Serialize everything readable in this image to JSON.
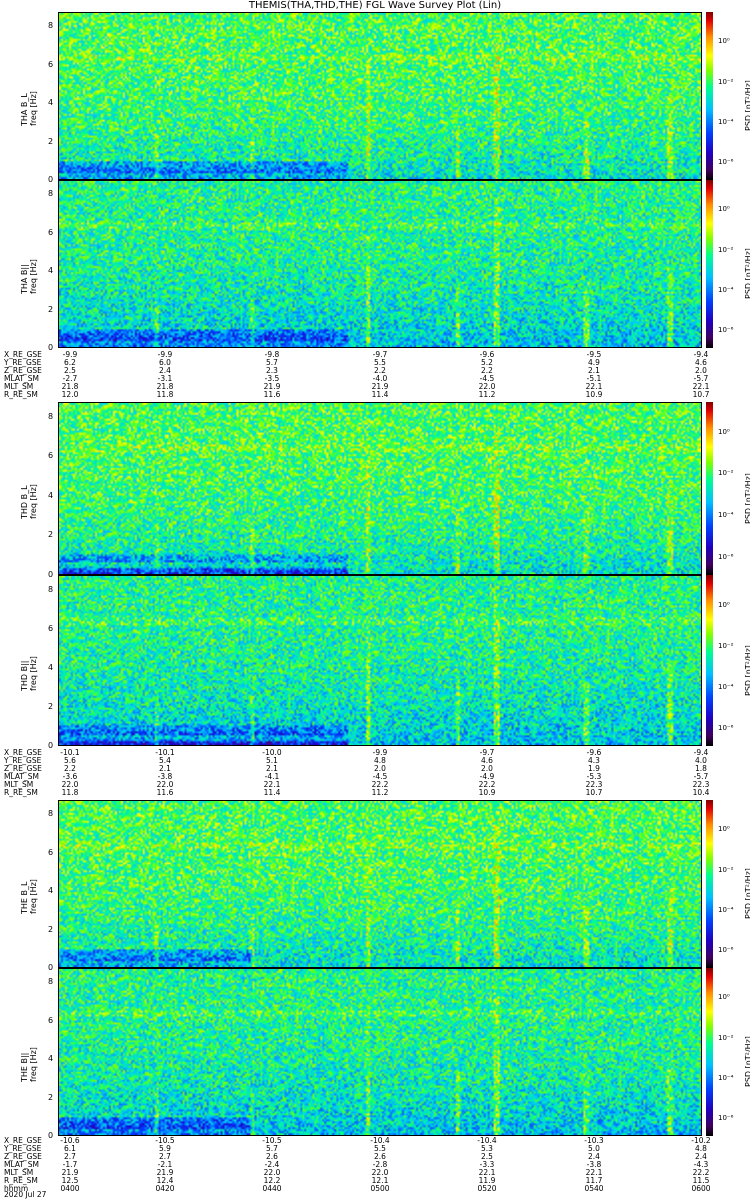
{
  "title": "THEMIS(THA,THD,THE) FGL Wave Survey Plot (Lin)",
  "colorbar": {
    "label": "PSD [nT²/Hz]",
    "ticks": [
      "10⁰",
      "10⁻²",
      "10⁻⁴",
      "10⁻⁶"
    ]
  },
  "row_labels": [
    "X_RE_GSE",
    "Y_RE_GSE",
    "Z_RE_GSE",
    "MLAT_SM",
    "MLT_SM",
    "R_RE_SM"
  ],
  "time_label": "hhmm",
  "date": "2020 Jul 27",
  "chart_data": {
    "type": "heatmap",
    "x_ticks": [
      "0400",
      "0420",
      "0440",
      "0500",
      "0520",
      "0540",
      "0600"
    ],
    "y_ticks": [
      "0",
      "2",
      "4",
      "6",
      "8"
    ],
    "ylim": [
      0,
      8
    ],
    "color_scale": {
      "type": "log",
      "range": [
        1e-07,
        10.0
      ],
      "ticks": [
        1,
        0.01,
        0.0001,
        1e-06
      ]
    },
    "panels": [
      {
        "probe": "THA",
        "ylabel": "THA B_L",
        "yunit": "freq [Hz]"
      },
      {
        "probe": "THA",
        "ylabel": "THA B||",
        "yunit": "freq [Hz]"
      },
      {
        "probe": "THD",
        "ylabel": "THD B_L",
        "yunit": "freq [Hz]"
      },
      {
        "probe": "THD",
        "ylabel": "THD B||",
        "yunit": "freq [Hz]"
      },
      {
        "probe": "THE",
        "ylabel": "THE B_L",
        "yunit": "freq [Hz]"
      },
      {
        "probe": "THE",
        "ylabel": "THE B||",
        "yunit": "freq [Hz]"
      }
    ],
    "ephemeris": [
      {
        "probe": "THA",
        "rows": [
          [
            "-9.9",
            "-9.9",
            "-9.8",
            "-9.7",
            "-9.6",
            "-9.5",
            "-9.4"
          ],
          [
            "6.2",
            "6.0",
            "5.7",
            "5.5",
            "5.2",
            "4.9",
            "4.6"
          ],
          [
            "2.5",
            "2.4",
            "2.3",
            "2.2",
            "2.2",
            "2.1",
            "2.0"
          ],
          [
            "-2.7",
            "-3.1",
            "-3.5",
            "-4.0",
            "-4.5",
            "-5.1",
            "-5.7"
          ],
          [
            "21.8",
            "21.8",
            "21.9",
            "21.9",
            "22.0",
            "22.1",
            "22.1"
          ],
          [
            "12.0",
            "11.8",
            "11.6",
            "11.4",
            "11.2",
            "10.9",
            "10.7"
          ]
        ]
      },
      {
        "probe": "THD",
        "rows": [
          [
            "-10.1",
            "-10.1",
            "-10.0",
            "-9.9",
            "-9.7",
            "-9.6",
            "-9.4"
          ],
          [
            "5.6",
            "5.4",
            "5.1",
            "4.8",
            "4.6",
            "4.3",
            "4.0"
          ],
          [
            "2.2",
            "2.1",
            "2.1",
            "2.0",
            "2.0",
            "1.9",
            "1.8"
          ],
          [
            "-3.6",
            "-3.8",
            "-4.1",
            "-4.5",
            "-4.9",
            "-5.3",
            "-5.7"
          ],
          [
            "22.0",
            "22.0",
            "22.1",
            "22.2",
            "22.2",
            "22.3",
            "22.3"
          ],
          [
            "11.8",
            "11.6",
            "11.4",
            "11.2",
            "10.9",
            "10.7",
            "10.4"
          ]
        ]
      },
      {
        "probe": "THE",
        "rows": [
          [
            "-10.6",
            "-10.5",
            "-10.5",
            "-10.4",
            "-10.4",
            "-10.3",
            "-10.2"
          ],
          [
            "6.1",
            "5.9",
            "5.7",
            "5.5",
            "5.3",
            "5.0",
            "4.8"
          ],
          [
            "2.7",
            "2.7",
            "2.6",
            "2.6",
            "2.5",
            "2.4",
            "2.4"
          ],
          [
            "-1.7",
            "-2.1",
            "-2.4",
            "-2.8",
            "-3.3",
            "-3.8",
            "-4.3"
          ],
          [
            "21.9",
            "21.9",
            "22.0",
            "22.0",
            "22.1",
            "22.1",
            "22.2"
          ],
          [
            "12.5",
            "12.4",
            "12.2",
            "12.1",
            "11.9",
            "11.7",
            "11.5"
          ]
        ]
      }
    ]
  }
}
